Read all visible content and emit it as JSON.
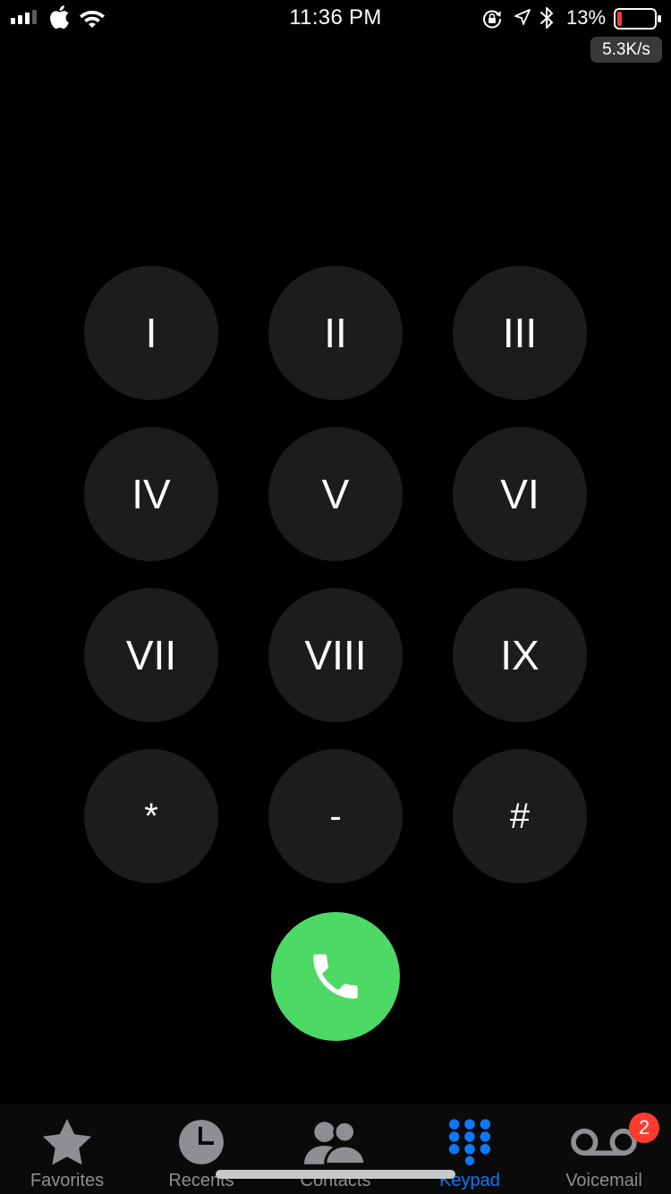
{
  "status_bar": {
    "time": "11:36 PM",
    "battery_percent": "13%",
    "battery_level": 0.13,
    "net_speed": "5.3K/s",
    "icons": [
      "signal-icon",
      "apple-icon",
      "wifi-icon",
      "lock-rotation-icon",
      "location-icon",
      "bluetooth-icon",
      "battery-icon"
    ]
  },
  "keypad": {
    "keys": [
      "I",
      "II",
      "III",
      "IV",
      "V",
      "VI",
      "VII",
      "VIII",
      "IX",
      "*",
      "-",
      "#"
    ],
    "call_icon": "phone-icon"
  },
  "tab_bar": {
    "tabs": [
      {
        "label": "Favorites",
        "icon": "star-icon"
      },
      {
        "label": "Recents",
        "icon": "clock-icon"
      },
      {
        "label": "Contacts",
        "icon": "contacts-icon"
      },
      {
        "label": "Keypad",
        "icon": "keypad-icon"
      },
      {
        "label": "Voicemail",
        "icon": "voicemail-icon"
      }
    ],
    "active": "Keypad",
    "voicemail_badge": "2"
  },
  "colors": {
    "background": "#000000",
    "key_background": "#1c1c1c",
    "call_green": "#4cd964",
    "active_blue": "#0a7aff",
    "inactive_gray": "#8e8e93",
    "badge_red": "#ff3b30",
    "battery_red": "#ff3b30"
  }
}
